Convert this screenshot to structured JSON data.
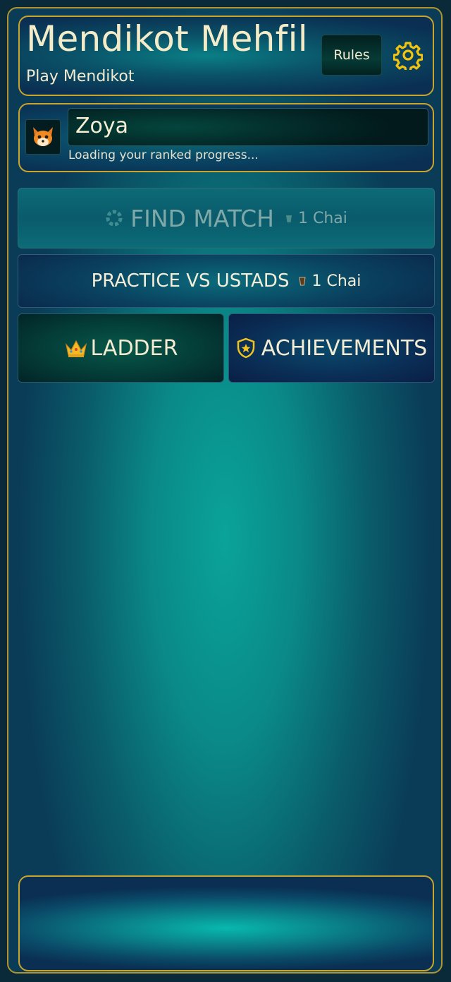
{
  "header": {
    "title": "Mendikot Mehfil",
    "subtitle": "Play Mendikot",
    "rules_label": "Rules",
    "settings_icon": "gear-icon"
  },
  "profile": {
    "avatar_icon": "fox-avatar-icon",
    "name": "Zoya",
    "status": "Loading your ranked progress..."
  },
  "actions": {
    "find_match": {
      "label": "FIND MATCH",
      "cost": "1 Chai",
      "state": "disabled"
    },
    "practice": {
      "label": "PRACTICE VS USTADS",
      "cost": "1 Chai"
    },
    "ladder": {
      "label": "LADDER",
      "icon": "crown-icon"
    },
    "achievements": {
      "label": "ACHIEVEMENTS",
      "icon": "shield-star-icon"
    }
  },
  "colors": {
    "accent_gold": "#c9a52c",
    "text_cream": "#f3ecd2",
    "background_teal": "#0a8a88"
  }
}
